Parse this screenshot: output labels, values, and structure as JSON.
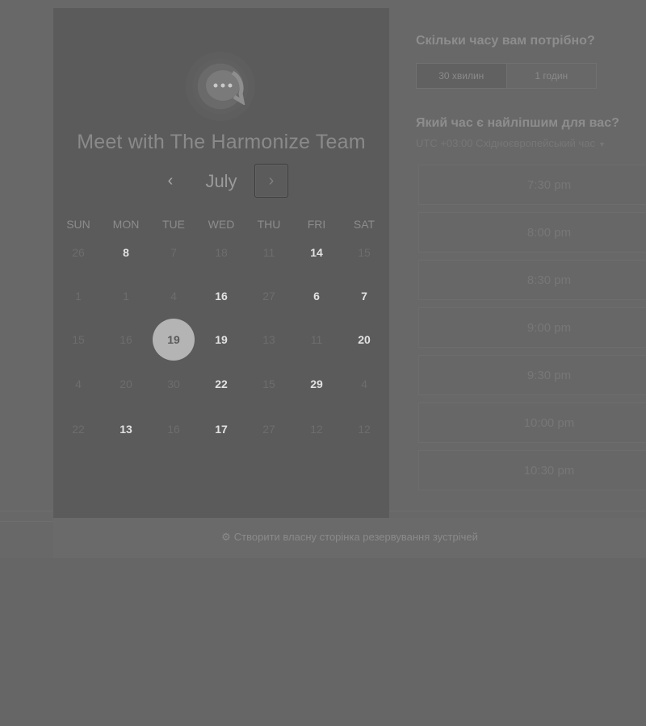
{
  "calendar": {
    "team_title": "Meet with The Harmonize Team",
    "month": "July",
    "prev_icon": "‹",
    "next_icon": "›",
    "weekdays": [
      "SUN",
      "MON",
      "TUE",
      "WED",
      "THU",
      "FRI",
      "SAT"
    ],
    "weeks": [
      [
        {
          "label": "26",
          "available": false
        },
        {
          "label": "8",
          "available": true
        },
        {
          "label": "7",
          "available": false
        },
        {
          "label": "18",
          "available": false
        },
        {
          "label": "11",
          "available": false
        },
        {
          "label": "14",
          "available": true
        },
        {
          "label": "15",
          "available": false
        }
      ],
      [
        {
          "label": "1",
          "available": false
        },
        {
          "label": "1",
          "available": false
        },
        {
          "label": "4",
          "available": false
        },
        {
          "label": "16",
          "available": true
        },
        {
          "label": "27",
          "available": false
        },
        {
          "label": "6",
          "available": true
        },
        {
          "label": "7",
          "available": true
        }
      ],
      [
        {
          "label": "15",
          "available": false
        },
        {
          "label": "16",
          "available": false
        },
        {
          "label": "19",
          "available": true,
          "selected": true
        },
        {
          "label": "19",
          "available": true
        },
        {
          "label": "13",
          "available": false
        },
        {
          "label": "11",
          "available": false
        },
        {
          "label": "20",
          "available": true
        }
      ],
      [
        {
          "label": "4",
          "available": false
        },
        {
          "label": "20",
          "available": false
        },
        {
          "label": "30",
          "available": false
        },
        {
          "label": "22",
          "available": true
        },
        {
          "label": "15",
          "available": false
        },
        {
          "label": "29",
          "available": true
        },
        {
          "label": "4",
          "available": false
        }
      ],
      [
        {
          "label": "22",
          "available": false
        },
        {
          "label": "13",
          "available": true
        },
        {
          "label": "16",
          "available": false
        },
        {
          "label": "17",
          "available": true
        },
        {
          "label": "27",
          "available": false
        },
        {
          "label": "12",
          "available": false
        },
        {
          "label": "12",
          "available": false
        }
      ]
    ]
  },
  "duration": {
    "question": "Скільки часу вам потрібно?",
    "options": [
      "30 хвилин",
      "1 годин"
    ],
    "selected_index": 0
  },
  "time": {
    "question": "Який час є найліпшим для вас?",
    "timezone": "UTC +03:00 Східноєвропейський час",
    "slots": [
      "7:30 pm",
      "8:00 pm",
      "8:30 pm",
      "9:00 pm",
      "9:30 pm",
      "10:00 pm",
      "10:30 pm"
    ]
  },
  "footer": {
    "link": "Створити власну сторінка резервування зустрічей"
  },
  "colors": {
    "selected_day": "#b4b4b4",
    "overlay": "#666666"
  }
}
